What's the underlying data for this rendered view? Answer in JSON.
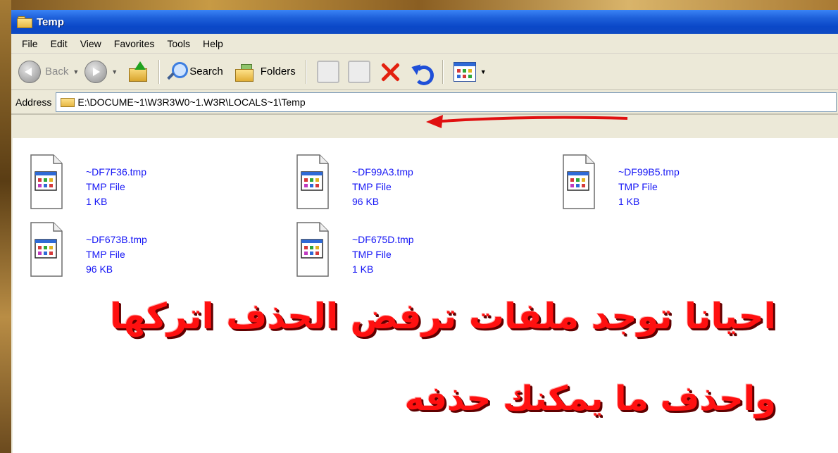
{
  "window": {
    "title": "Temp"
  },
  "menu": [
    "File",
    "Edit",
    "View",
    "Favorites",
    "Tools",
    "Help"
  ],
  "toolbar": {
    "back_label": "Back",
    "search_label": "Search",
    "folders_label": "Folders"
  },
  "address": {
    "label": "Address",
    "path": "E:\\DOCUME~1\\W3R3W0~1.W3R\\LOCALS~1\\Temp"
  },
  "files": [
    {
      "name": "~DF7F36.tmp",
      "type": "TMP File",
      "size": "1 KB"
    },
    {
      "name": "~DF99A3.tmp",
      "type": "TMP File",
      "size": "96 KB"
    },
    {
      "name": "~DF99B5.tmp",
      "type": "TMP File",
      "size": "1 KB"
    },
    {
      "name": "~DF673B.tmp",
      "type": "TMP File",
      "size": "96 KB"
    },
    {
      "name": "~DF675D.tmp",
      "type": "TMP File",
      "size": "1 KB"
    }
  ],
  "annotation": {
    "line1": "احيانا توجد ملفات ترفض الحذف اتركها",
    "line2": "واحذف ما يمكنك حذفه",
    "color": "#ff1010"
  },
  "icons": [
    "folder-icon",
    "back-icon",
    "forward-icon",
    "up-folder-icon",
    "search-icon",
    "folders-icon",
    "move-to-icon",
    "copy-to-icon",
    "delete-icon",
    "undo-icon",
    "views-icon",
    "tmp-file-icon"
  ]
}
